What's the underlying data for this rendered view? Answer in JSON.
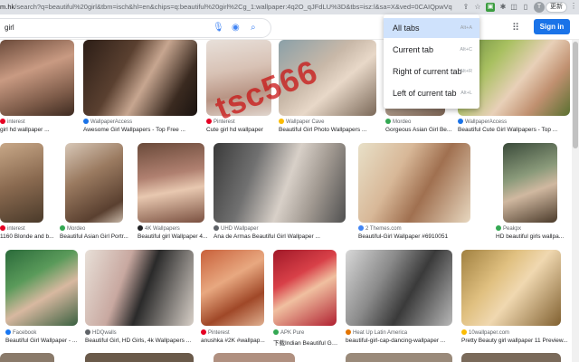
{
  "browser": {
    "url_host": "m.hk",
    "url_rest": "/search?q=beautiful%20girl&tbm=isch&hl=en&chips=q:beautiful%20girl%2Cg_1:wallpaper:4q2O_qJFdLU%3D&tbs=isz:l&sa=X&ved=0CAIQpwVqFw...",
    "update_label": "更新",
    "profile_initial": "T"
  },
  "search": {
    "query": "girl",
    "signin_label": "Sign in"
  },
  "tab_menu": {
    "items": [
      {
        "label": "All tabs",
        "shortcut": "Alt+A"
      },
      {
        "label": "Current tab",
        "shortcut": "Alt+C"
      },
      {
        "label": "Right of current tab",
        "shortcut": "Alt+R"
      },
      {
        "label": "Left of current tab",
        "shortcut": "Alt+L"
      }
    ]
  },
  "watermark": "tsc566",
  "colors": {
    "accent": "#1a73e8",
    "menu_highlight": "#cfe2fc",
    "watermark": "#c81414",
    "extension_green": "#3c9d41"
  },
  "results": [
    {
      "source": "interest",
      "title": "girl hd wallpaper ..."
    },
    {
      "source": "WallpaperAccess",
      "title": "Awesome Girl Wallpapers - Top Free ..."
    },
    {
      "source": "Pinterest",
      "title": "Cute girl hd wallpaper"
    },
    {
      "source": "Wallpaper Cave",
      "title": "Beautiful Girl Photo Wallpapers ..."
    },
    {
      "source": "Mordeo",
      "title": "Gorgeous Asian Girl Be..."
    },
    {
      "source": "WallpaperAccess",
      "title": "Beautiful Cute Girl Wallpapers - Top ..."
    },
    {
      "source": "interest",
      "title": "1160 Blonde and b..."
    },
    {
      "source": "Mordeo",
      "title": "Beautiful Asian Girl Portr..."
    },
    {
      "source": "4K Wallpapers",
      "title": "Beautiful girl Wallpaper 4..."
    },
    {
      "source": "UHD Wallpaper",
      "title": "Ana de Armas Beautiful Girl Wallpaper ..."
    },
    {
      "source": "2 Themes.com",
      "title": "Beautiful-Girl Wallpaper #6910051"
    },
    {
      "source": "Peakpx",
      "title": "HD beautiful girls wallpa..."
    },
    {
      "source": "Facebook",
      "title": "Beautiful Girl Wallpaper - ..."
    },
    {
      "source": "HDQwalls",
      "title": "Beautiful Girl, HD Girls, 4k Wallpapers ..."
    },
    {
      "source": "Pinterest",
      "title": "anushka #2K #wallpap..."
    },
    {
      "source": "APK Pure",
      "title": "下载Indian Beautiful Gir..."
    },
    {
      "source": "Heat Up Latin America",
      "title": "beautiful-girl-cap-dancing-wallpaper ..."
    },
    {
      "source": "10wallpaper.com",
      "title": "Pretty Beauty girl wallpaper 11 Preview..."
    }
  ]
}
